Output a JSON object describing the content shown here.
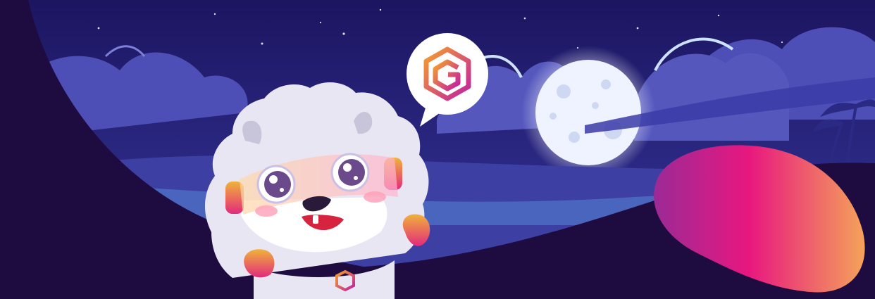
{
  "banner": {
    "scene": "night-landscape",
    "elements": {
      "moon": "full-moon",
      "speech_bubble_icon": "hexagon-spiral-logo",
      "mascot": "white-furry-mascot-with-headphones",
      "blob": "pink-orange-gradient-blob"
    },
    "colors": {
      "sky_dark": "#1c1560",
      "sky_light": "#3c3fae",
      "foreground_dark": "#1e0b3f",
      "moon": "#eef3ff",
      "blob_pink": "#e8177f",
      "blob_orange": "#f4a35a",
      "mascot_fur": "#e9e6f3"
    }
  }
}
